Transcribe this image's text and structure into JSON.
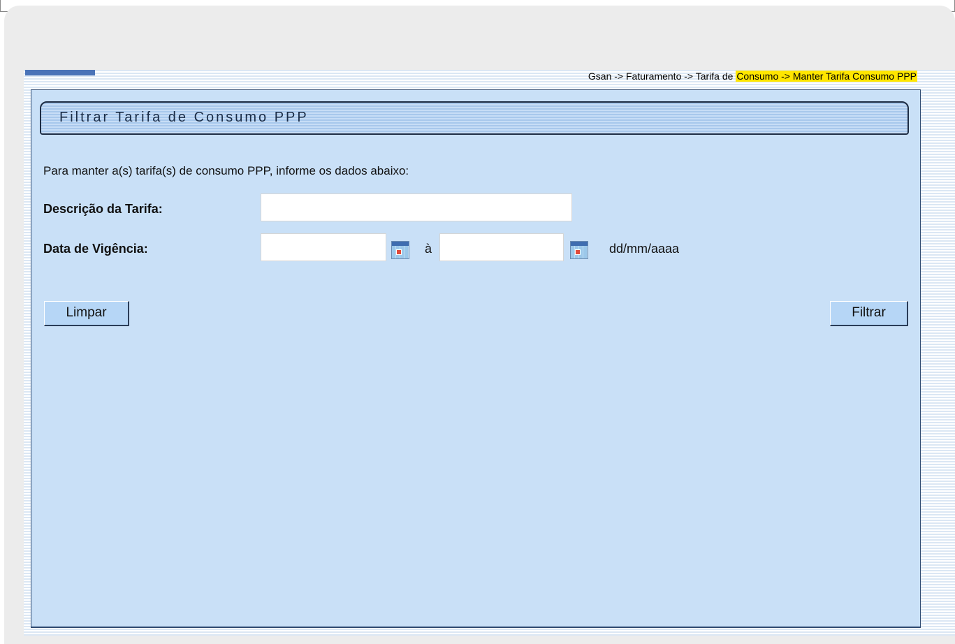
{
  "breadcrumb": {
    "prefix": "Gsan -> Faturamento -> Tarifa de ",
    "highlight": "Consumo -> Manter Tarifa Consumo PPP"
  },
  "panel": {
    "title": "Filtrar Tarifa de Consumo PPP",
    "instructions": "Para manter a(s) tarifa(s) de consumo PPP, informe os dados abaixo:"
  },
  "form": {
    "descricao_label": "Descrição da Tarifa:",
    "descricao_value": "",
    "vigencia_label": "Data de Vigência:",
    "vigencia_inicio_value": "",
    "separator": "à",
    "vigencia_fim_value": "",
    "date_format": "dd/mm/aaaa"
  },
  "buttons": {
    "limpar": "Limpar",
    "filtrar": "Filtrar"
  },
  "icons": {
    "calendar": "calendar-icon"
  },
  "colors": {
    "panel_bg": "#c9e0f7",
    "highlight": "#ffe600",
    "button_bg": "#b6d6f6"
  }
}
